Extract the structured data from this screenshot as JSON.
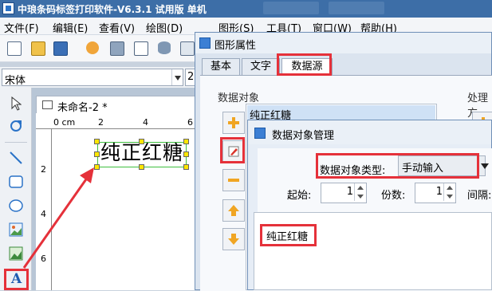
{
  "app": {
    "title": "中琅条码标签打印软件-V6.3.1 试用版 单机"
  },
  "menu": [
    {
      "label": "文件(F)"
    },
    {
      "label": "编辑(E)"
    },
    {
      "label": "查看(V)"
    },
    {
      "label": "绘图(D)"
    },
    {
      "label": "图形(S)"
    },
    {
      "label": "工具(T)"
    },
    {
      "label": "窗口(W)"
    },
    {
      "label": "帮助(H)"
    }
  ],
  "font": {
    "family_value": "宋体",
    "size_value": "2"
  },
  "document": {
    "tab_label": "未命名-2 *",
    "ruler_top": [
      "0 cm",
      "2",
      "4",
      "6"
    ],
    "ruler_left": [
      "2",
      "4",
      "6"
    ],
    "label_text": "纯正红糖"
  },
  "properties_dialog": {
    "title": "图形属性",
    "tabs": [
      {
        "label": "基本"
      },
      {
        "label": "文字"
      },
      {
        "label": "数据源"
      }
    ],
    "data_object_label": "数据对象",
    "process_label": "处理方",
    "list_items": [
      "纯正红糖"
    ]
  },
  "manager_dialog": {
    "title": "数据对象管理",
    "type_label": "数据对象类型:",
    "type_value": "手动输入",
    "start_label": "起始:",
    "start_value": "1",
    "copies_label": "份数:",
    "copies_value": "1",
    "interval_label": "间隔:",
    "content": "纯正红糖"
  },
  "colors": {
    "highlight": "#e5313a",
    "title_bar": "#3d6ea7",
    "selection_handle": "#ffe600",
    "arrow": "#e5313a"
  }
}
